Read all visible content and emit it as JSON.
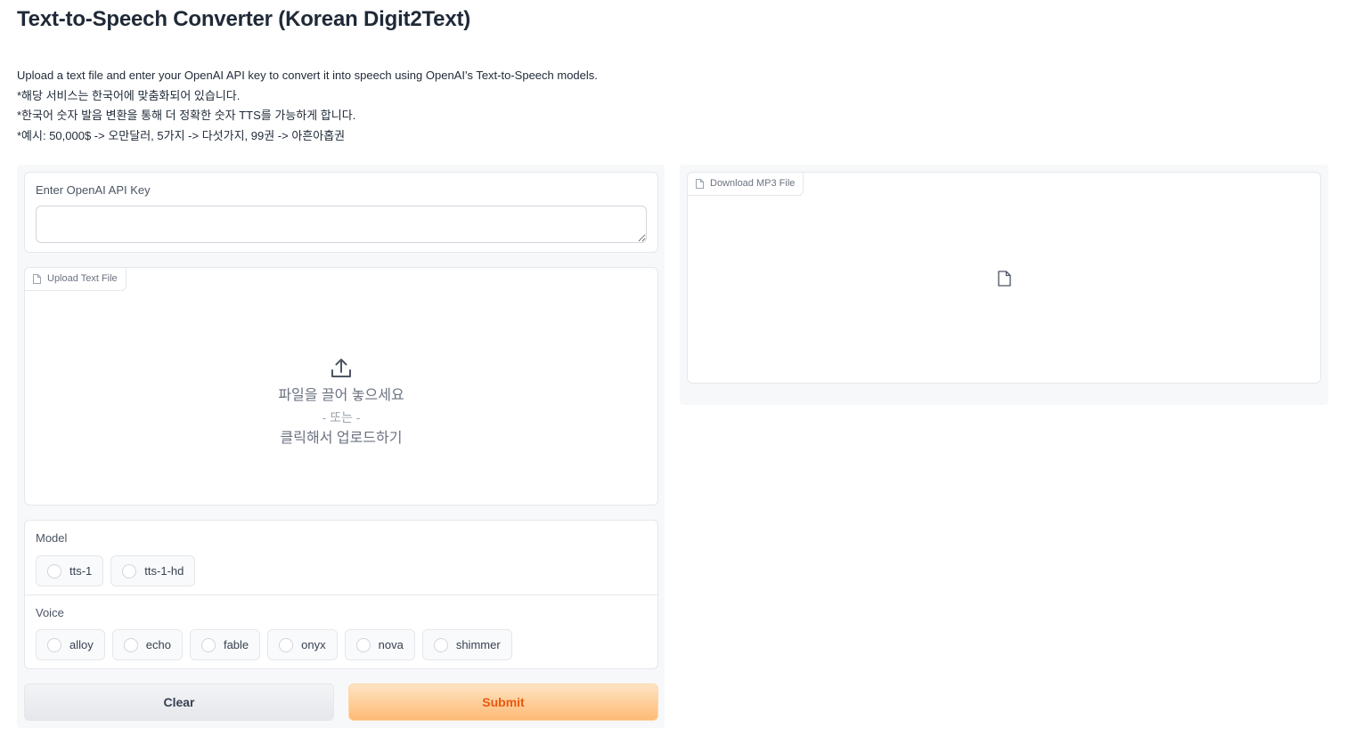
{
  "header": {
    "title": "Text-to-Speech Converter (Korean Digit2Text)",
    "description_lines": [
      "Upload a text file and enter your OpenAI API key to convert it into speech using OpenAI's Text-to-Speech models.",
      "*해당 서비스는 한국어에 맞춤화되어 있습니다.",
      "*한국어 숫자 발음 변환을 통해 더 정확한 숫자 TTS를 가능하게 합니다.",
      "*예시: 50,000$ -> 오만달러, 5가지 -> 다섯가지, 99권 -> 아흔아홉권"
    ]
  },
  "api_key": {
    "label": "Enter OpenAI API Key",
    "value": "",
    "placeholder": ""
  },
  "upload": {
    "tab_label": "Upload Text File",
    "drop_text": "파일을 끌어 놓으세요",
    "or_text": "- 또는 -",
    "click_text": "클릭해서 업로드하기",
    "icon": "upload-icon"
  },
  "model": {
    "label": "Model",
    "options": [
      "tts-1",
      "tts-1-hd"
    ],
    "selected": null
  },
  "voice": {
    "label": "Voice",
    "options": [
      "alloy",
      "echo",
      "fable",
      "onyx",
      "nova",
      "shimmer"
    ],
    "selected": null
  },
  "buttons": {
    "clear_label": "Clear",
    "submit_label": "Submit"
  },
  "download": {
    "tab_label": "Download MP3 File",
    "icon": "file-icon"
  },
  "colors": {
    "submit_text": "#ea580c",
    "submit_bg_top": "#ffe4c4",
    "submit_bg_bottom": "#fdba74",
    "panel_bg": "#f7f8fa",
    "border": "#e5e7eb"
  }
}
